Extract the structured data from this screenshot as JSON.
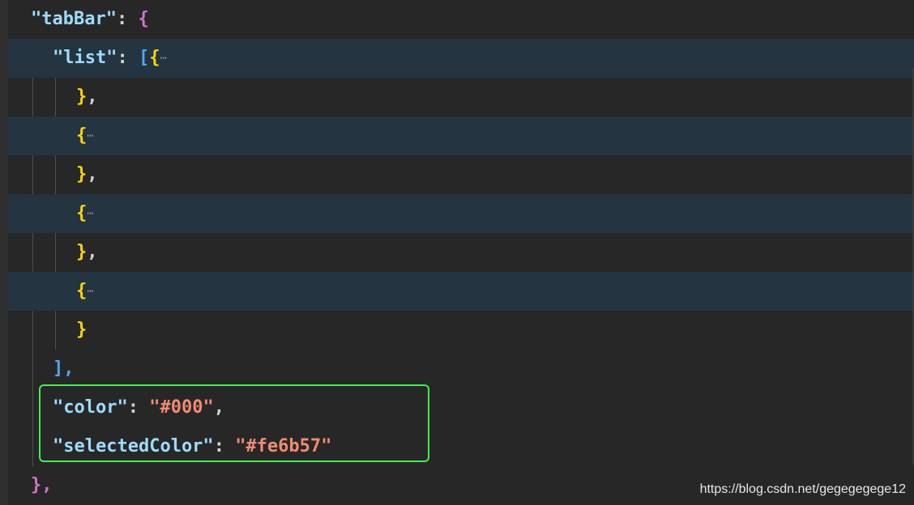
{
  "colors": {
    "background": "#272727",
    "highlight_row": "#243441",
    "key": "#9cdcfe",
    "string": "#f08b73",
    "brace_outer": "#d472d0",
    "brace_inner": "#ffd700",
    "bracket": "#4fa8f0",
    "selection_box": "#3ef34d"
  },
  "code": {
    "tabbar_key": "\"tabBar\"",
    "colon": ":",
    "open_brace": "{",
    "list_key": "\"list\"",
    "open_bracket": "[",
    "fold_marker": "⋯",
    "close_obj_comma": "},",
    "open_obj": "{",
    "close_obj": "}",
    "close_bracket_comma": "],",
    "color_key": "\"color\"",
    "color_value": "\"#000\"",
    "comma": ",",
    "selectedcolor_key": "\"selectedColor\"",
    "selectedcolor_value": "\"#fe6b57\"",
    "close_tabbar": "},"
  },
  "watermark": "https://blog.csdn.net/gegegegege12"
}
